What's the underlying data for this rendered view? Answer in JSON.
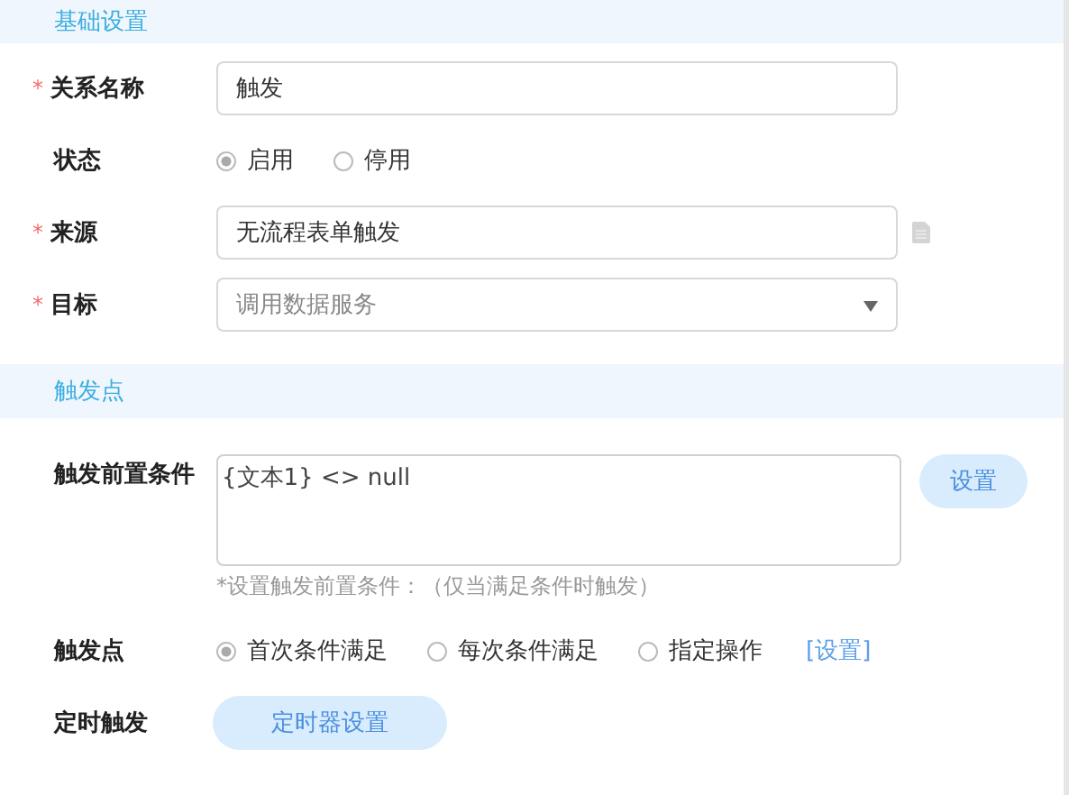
{
  "sections": [
    {
      "title": "基础设置",
      "rows": [
        {
          "kind": "input",
          "required_mark": "*",
          "label": "关系名称",
          "value": "触发"
        },
        {
          "kind": "radio",
          "label": "状态",
          "options": [
            {
              "label": "启用",
              "selected": true
            },
            {
              "label": "停用",
              "selected": false
            }
          ]
        },
        {
          "kind": "input",
          "required_mark": "*",
          "label": "来源",
          "value": "无流程表单触发",
          "trailing_icon": true
        },
        {
          "kind": "select",
          "required_mark": "*",
          "label": "目标",
          "placeholder": "调用数据服务"
        }
      ]
    },
    {
      "title": "触发点",
      "rows": [
        {
          "kind": "textarea",
          "label": "触发前置条件",
          "value": "{文本1}  <>  null",
          "button": "设置",
          "hint": "*设置触发前置条件：（仅当满足条件时触发）"
        },
        {
          "kind": "radio",
          "label": "触发点",
          "options": [
            {
              "label": "首次条件满足",
              "selected": true
            },
            {
              "label": "每次条件满足",
              "selected": false
            },
            {
              "label": "指定操作",
              "selected": false
            }
          ],
          "link": "[设置]"
        },
        {
          "kind": "button",
          "label": "定时触发",
          "button": "定时器设置"
        }
      ]
    }
  ]
}
